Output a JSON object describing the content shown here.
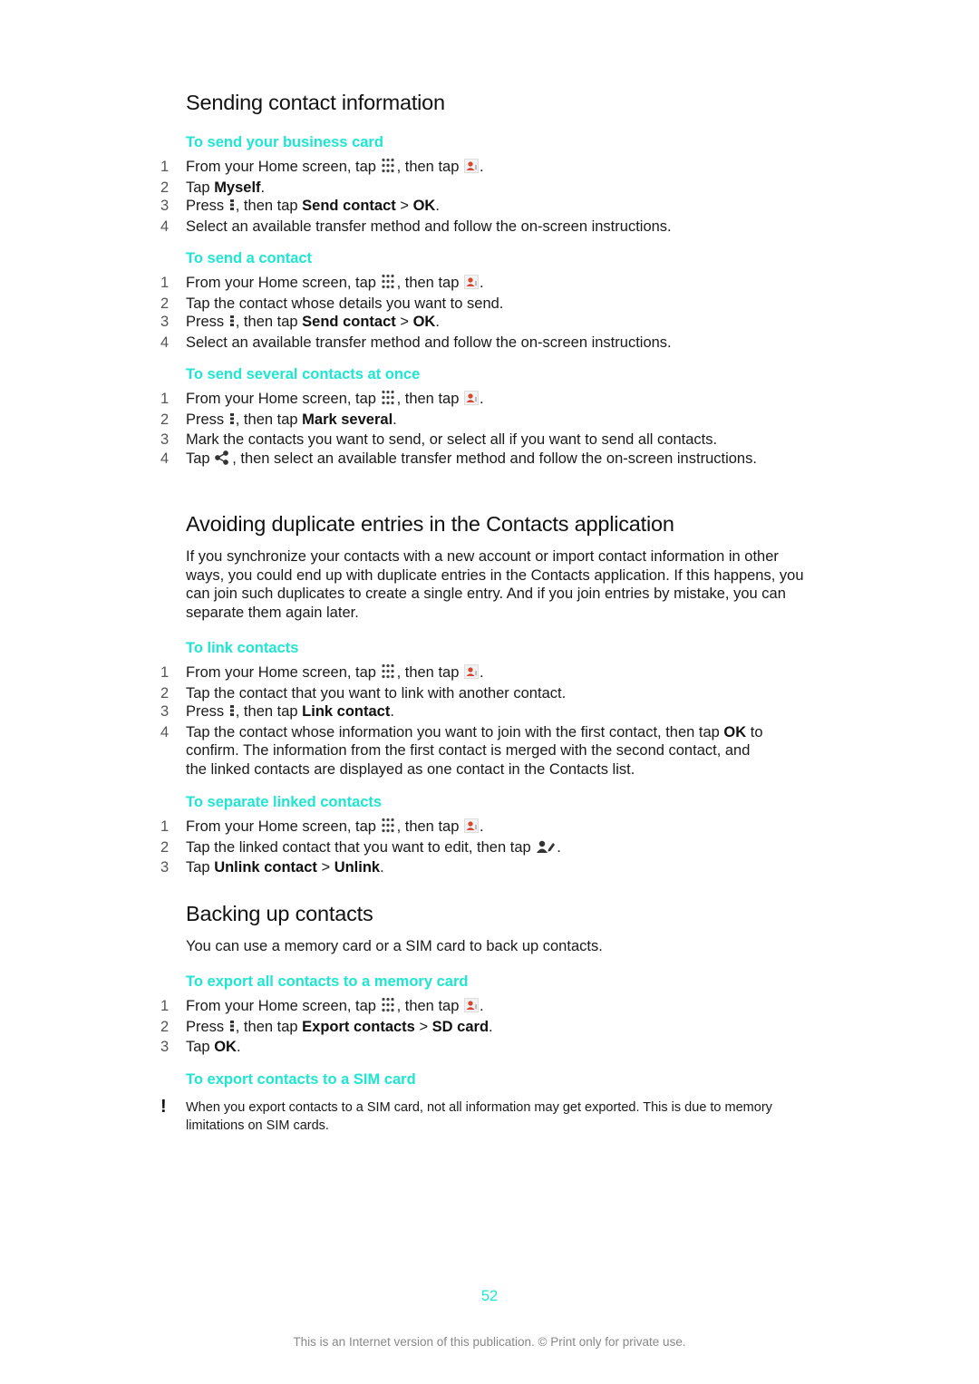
{
  "sections": [
    {
      "title": "Sending contact information",
      "procedures": [
        {
          "title": "To send your business card",
          "steps": [
            {
              "num": "1",
              "parts": [
                "From your Home screen, tap ",
                "{apps}",
                ", then tap ",
                "{contacts}",
                "."
              ]
            },
            {
              "num": "2",
              "parts": [
                "Tap ",
                "[b]Myself",
                "."
              ]
            },
            {
              "num": "3",
              "parts": [
                "Press ",
                "{menu}",
                ", then tap ",
                "[b]Send contact",
                " > ",
                "[b]OK",
                "."
              ]
            },
            {
              "num": "4",
              "parts": [
                "Select an available transfer method and follow the on-screen instructions."
              ]
            }
          ]
        },
        {
          "title": "To send a contact",
          "steps": [
            {
              "num": "1",
              "parts": [
                "From your Home screen, tap ",
                "{apps}",
                ", then tap ",
                "{contacts}",
                "."
              ]
            },
            {
              "num": "2",
              "parts": [
                "Tap the contact whose details you want to send."
              ]
            },
            {
              "num": "3",
              "parts": [
                "Press ",
                "{menu}",
                ", then tap ",
                "[b]Send contact",
                " > ",
                "[b]OK",
                "."
              ]
            },
            {
              "num": "4",
              "parts": [
                "Select an available transfer method and follow the on-screen instructions."
              ]
            }
          ]
        },
        {
          "title": "To send several contacts at once",
          "steps": [
            {
              "num": "1",
              "parts": [
                "From your Home screen, tap ",
                "{apps}",
                ", then tap ",
                "{contacts}",
                "."
              ]
            },
            {
              "num": "2",
              "parts": [
                "Press ",
                "{menu}",
                ", then tap ",
                "[b]Mark several",
                "."
              ]
            },
            {
              "num": "3",
              "parts": [
                "Mark the contacts you want to send, or select all if you want to send all contacts."
              ]
            },
            {
              "num": "4",
              "parts": [
                "Tap ",
                "{share}",
                ", then select an available transfer method and follow the on-screen instructions."
              ]
            }
          ]
        }
      ]
    },
    {
      "title": "Avoiding duplicate entries in the Contacts application",
      "intro": "If you synchronize your contacts with a new account or import contact information in other ways, you could end up with duplicate entries in the Contacts application. If this happens, you can join such duplicates to create a single entry. And if you join entries by mistake, you can separate them again later.",
      "procedures": [
        {
          "title": "To link contacts",
          "steps": [
            {
              "num": "1",
              "parts": [
                "From your Home screen, tap ",
                "{apps}",
                ", then tap ",
                "{contacts}",
                "."
              ]
            },
            {
              "num": "2",
              "parts": [
                "Tap the contact that you want to link with another contact."
              ]
            },
            {
              "num": "3",
              "parts": [
                "Press ",
                "{menu}",
                ", then tap ",
                "[b]Link contact",
                "."
              ]
            },
            {
              "num": "4",
              "parts": [
                "Tap the contact whose information you want to join with the first contact, then tap ",
                "[b]OK",
                " to confirm. The information from the first contact is merged with the second contact, and the linked contacts are displayed as one contact in the Contacts list."
              ]
            }
          ]
        },
        {
          "title": "To separate linked contacts",
          "steps": [
            {
              "num": "1",
              "parts": [
                "From your Home screen, tap ",
                "{apps}",
                ", then tap ",
                "{contacts}",
                "."
              ]
            },
            {
              "num": "2",
              "parts": [
                "Tap the linked contact that you want to edit, then tap ",
                "{edit}",
                "."
              ]
            },
            {
              "num": "3",
              "parts": [
                "Tap ",
                "[b]Unlink contact",
                " > ",
                "[b]Unlink",
                "."
              ]
            }
          ]
        }
      ]
    },
    {
      "title": "Backing up contacts",
      "intro": "You can use a memory card or a SIM card to back up contacts.",
      "procedures": [
        {
          "title": "To export all contacts to a memory card",
          "steps": [
            {
              "num": "1",
              "parts": [
                "From your Home screen, tap ",
                "{apps}",
                ", then tap ",
                "{contacts}",
                "."
              ]
            },
            {
              "num": "2",
              "parts": [
                "Press ",
                "{menu}",
                ", then tap ",
                "[b]Export contacts",
                " > ",
                "[b]SD card",
                "."
              ]
            },
            {
              "num": "3",
              "parts": [
                "Tap ",
                "[b]OK",
                "."
              ]
            }
          ]
        },
        {
          "title": "To export contacts to a SIM card",
          "note_icon": "!",
          "note": "When you export contacts to a SIM card, not all information may get exported. This is due to memory limitations on SIM cards."
        }
      ]
    }
  ],
  "icons": {
    "apps": "apps-grid-icon",
    "contacts": "contacts-app-icon",
    "menu": "overflow-menu-icon",
    "share": "share-icon",
    "edit": "edit-contact-icon"
  },
  "colors": {
    "accent": "#1ee6d2",
    "text": "#1a1a1a",
    "footer": "#888888"
  },
  "page_number": "52",
  "footer": "This is an Internet version of this publication. © Print only for private use."
}
